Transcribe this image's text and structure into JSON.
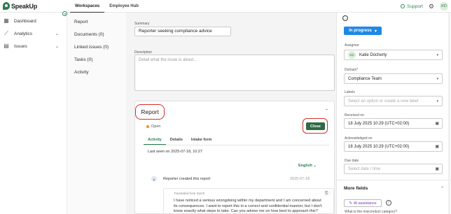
{
  "app": {
    "logo_text": "SpeakUp",
    "brand_color": "#2e7d4f"
  },
  "top_tabs": [
    {
      "label": "Workspaces",
      "active": true
    },
    {
      "label": "Employee Hub",
      "active": false
    }
  ],
  "header": {
    "support_label": "Support",
    "avatar_initials": "KD"
  },
  "sidebar": {
    "items": [
      {
        "label": "Dashboard",
        "icon": "dashboard-icon"
      },
      {
        "label": "Analytics",
        "icon": "analytics-icon"
      },
      {
        "label": "Issues",
        "icon": "issues-icon"
      }
    ]
  },
  "subnav": {
    "items": [
      "Report",
      "Documents (0)",
      "Linked issues (0)",
      "Tasks (0)",
      "Activity"
    ]
  },
  "main": {
    "summary_label": "Summary",
    "summary_value": "Reporter seeking compliance advice",
    "description_label": "Description",
    "description_placeholder": "Detail what the issue is about...",
    "report": {
      "title": "Report",
      "status": "Open",
      "close_label": "Close",
      "tabs": [
        "Activity",
        "Details",
        "Intake form"
      ],
      "last_seen": "Last seen on 2025-07-18, 10:27",
      "language": "English",
      "entry_text": "Reporter created this report",
      "entry_date": "2025-07-18",
      "translated_label": "Translated from Dutch",
      "message": "I have noticed a serious wrongdoing within my department and I am concerned about its consequences. I want to report this in a correct and confidential manner, but I don't know exactly what steps to take. Can you advise me on how best to approach this?"
    }
  },
  "right_panel": {
    "status_button": "In progress",
    "assignee_label": "Assignee",
    "assignee_initials": "KD",
    "assignee_name": "Katie Docherty",
    "domain_label": "Domain*",
    "domain_value": "Compliance Team",
    "labels_label": "Labels",
    "labels_placeholder": "Select an option or create a new label",
    "received_label": "Received on",
    "received_value": "18 July 2025 10:29 (UTC+02:00)",
    "acknowledged_label": "Acknowledged on",
    "acknowledged_value": "18 July 2025 10:29 (UTC+02:00)",
    "due_label": "Due date",
    "due_placeholder": "Select date / time",
    "more_fields": "More fields",
    "ai_button": "AI assistance",
    "question": "What is the misconduct category?"
  },
  "colors": {
    "highlight_red": "#d32f2f",
    "primary_blue": "#1e88e5",
    "close_green": "#2e6b45",
    "status_orange": "#f08c28"
  }
}
